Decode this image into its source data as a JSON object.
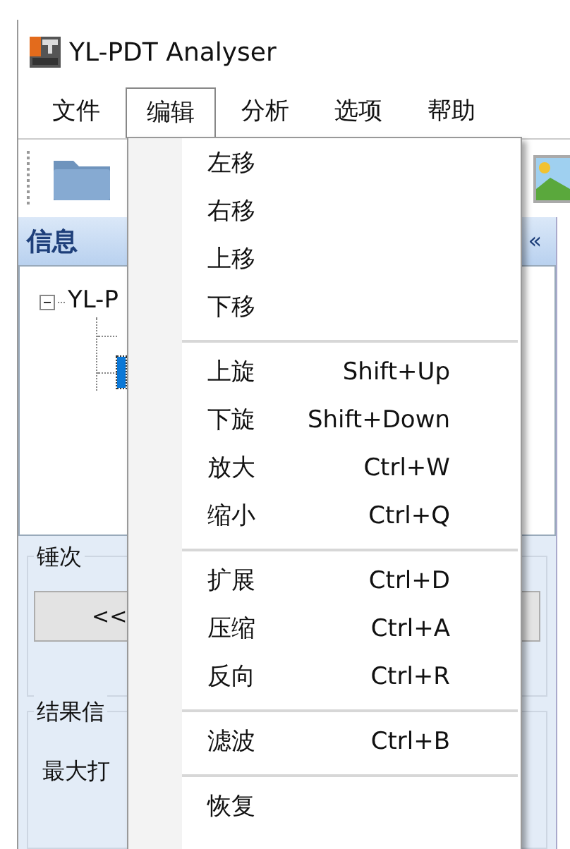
{
  "window": {
    "title": "YL-PDT Analyser"
  },
  "menu_bar": [
    {
      "label": "文件",
      "selected": false
    },
    {
      "label": "编辑",
      "selected": true
    },
    {
      "label": "分析",
      "selected": false
    },
    {
      "label": "选项",
      "selected": false
    },
    {
      "label": "帮助",
      "selected": false
    }
  ],
  "panel": {
    "title": "信息",
    "collapse": "«"
  },
  "tree": {
    "label": "YL-P",
    "expanded": true,
    "children": [
      {
        "selected": false
      },
      {
        "selected": true
      }
    ]
  },
  "hammer_group": {
    "title": "锤次",
    "button": "<<"
  },
  "result_group": {
    "title": "结果信",
    "row_label": "最大打"
  },
  "edit_menu": [
    {
      "kind": "item",
      "label": "左移"
    },
    {
      "kind": "item",
      "label": "右移"
    },
    {
      "kind": "item",
      "label": "上移"
    },
    {
      "kind": "item",
      "label": "下移"
    },
    {
      "kind": "separator"
    },
    {
      "kind": "item",
      "label": "上旋",
      "shortcut": "Shift+Up"
    },
    {
      "kind": "item",
      "label": "下旋",
      "shortcut": "Shift+Down"
    },
    {
      "kind": "item",
      "label": "放大",
      "shortcut": "Ctrl+W"
    },
    {
      "kind": "item",
      "label": "缩小",
      "shortcut": "Ctrl+Q"
    },
    {
      "kind": "separator"
    },
    {
      "kind": "item",
      "label": "扩展",
      "shortcut": "Ctrl+D"
    },
    {
      "kind": "item",
      "label": "压缩",
      "shortcut": "Ctrl+A"
    },
    {
      "kind": "item",
      "label": "反向",
      "shortcut": "Ctrl+R"
    },
    {
      "kind": "separator"
    },
    {
      "kind": "item",
      "label": "滤波",
      "shortcut": "Ctrl+B"
    },
    {
      "kind": "separator"
    },
    {
      "kind": "item",
      "label": "恢复"
    }
  ]
}
